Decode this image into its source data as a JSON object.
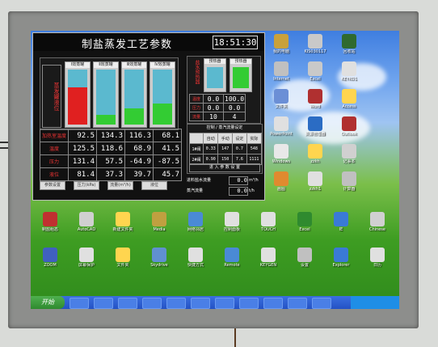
{
  "window": {
    "title": "制盐蒸发工艺参数",
    "time": "18:51:30"
  },
  "tanks": {
    "label": "蒸发罐液位",
    "items": [
      {
        "name": "Ⅰ效蒸罐",
        "level": 0.68,
        "color": "#e02020"
      },
      {
        "name": "Ⅱ效蒸罐",
        "level": 0.18,
        "color": "#33cc33"
      },
      {
        "name": "Ⅲ效蒸罐",
        "level": 0.3,
        "color": "#33cc33"
      },
      {
        "name": "Ⅳ效蒸罐",
        "level": 0.38,
        "color": "#33cc33"
      }
    ]
  },
  "params": {
    "rows": [
      {
        "label": "加热室温度",
        "values": [
          "92.5",
          "134.3",
          "116.3",
          "68.1"
        ]
      },
      {
        "label": "温度",
        "values": [
          "125.5",
          "118.6",
          "68.9",
          "41.5"
        ]
      },
      {
        "label": "压力",
        "values": [
          "131.4",
          "57.5",
          "-64.9",
          "-87.5"
        ]
      },
      {
        "label": "液位",
        "values": [
          "81.4",
          "37.3",
          "39.7",
          "45.7"
        ]
      }
    ]
  },
  "tabs": [
    "参数设置",
    "压力(kPa)",
    "流量(m³/h)",
    "液位"
  ],
  "side": {
    "label": "盐水预热器",
    "tanks": [
      {
        "name": "预热器",
        "color": "#5bb9cf"
      },
      {
        "name": "预热器",
        "color": "#33cc33"
      }
    ],
    "rows": [
      {
        "label": "温度",
        "values": [
          "0.0",
          "100.0"
        ]
      },
      {
        "label": "压力",
        "values": [
          "0.0",
          "0.0"
        ]
      },
      {
        "label": "流量",
        "values": [
          "10",
          "4"
        ]
      }
    ]
  },
  "control": {
    "header": "控制 / 蒸汽流量设定",
    "columns": [
      "自动",
      "手动",
      "设定",
      "实际"
    ],
    "rows": [
      {
        "label": "1#阀",
        "values": [
          "0.33",
          "147",
          "0.7",
          "548"
        ]
      },
      {
        "label": "2#阀",
        "values": [
          "0.90",
          "150",
          "7.6",
          "1111"
        ]
      }
    ],
    "footer": "进 入 参 数 设 置"
  },
  "flow": [
    {
      "label": "进料盐水流量",
      "value": "0.0",
      "unit": "m³/h"
    },
    {
      "label": "蒸汽流量",
      "value": "0.0",
      "unit": "t/h"
    }
  ],
  "desktop": {
    "right_icons": [
      {
        "label": "我的电脑",
        "color": "#c9a13b"
      },
      {
        "label": "KIS030117",
        "color": "#c9c9c9"
      },
      {
        "label": "回收站",
        "color": "#2f6a2f"
      },
      {
        "label": "Internet",
        "color": "#c0c0c0"
      },
      {
        "label": "Excel",
        "color": "#c9c9c9"
      },
      {
        "label": "KEYKO1",
        "color": "#e0e0e0"
      },
      {
        "label": "文件夹",
        "color": "#6b8fd6"
      },
      {
        "label": "Word",
        "color": "#b03030"
      },
      {
        "label": "Access",
        "color": "#ffd54f"
      },
      {
        "label": "PowerPoint",
        "color": "#e0e0e0"
      },
      {
        "label": "资源管理器",
        "color": "#2b6cc4"
      },
      {
        "label": "Outlook",
        "color": "#b03030"
      },
      {
        "label": "Windows",
        "color": "#e8e8e8"
      },
      {
        "label": "zzkh",
        "color": "#ffd54f"
      },
      {
        "label": "记事本",
        "color": "#d0d0d0"
      },
      {
        "label": "画图",
        "color": "#e08a2f"
      },
      {
        "label": "zzkh1",
        "color": "#e0e0e0"
      },
      {
        "label": "计算器",
        "color": "#c0c0c0"
      }
    ],
    "bottom_icons": [
      {
        "label": "制盐组态",
        "color": "#c03030"
      },
      {
        "label": "AutoCAD",
        "color": "#d0d0d0"
      },
      {
        "label": "新建文件夹",
        "color": "#ffd54f"
      },
      {
        "label": "Media",
        "color": "#c0a040"
      },
      {
        "label": "网络邻居",
        "color": "#4a8ad6"
      },
      {
        "label": "控制面板",
        "color": "#e0e0e0"
      },
      {
        "label": "TOUCH",
        "color": "#e0e0e0"
      },
      {
        "label": "Excel",
        "color": "#2f8a2f"
      },
      {
        "label": "IE",
        "color": "#3a7ad6"
      },
      {
        "label": "Chinese",
        "color": "#d0d0d0"
      },
      {
        "label": "ZOOM",
        "color": "#4060c0"
      },
      {
        "label": "屏幕保护",
        "color": "#e0e0e0"
      },
      {
        "label": "文件夹",
        "color": "#ffd54f"
      },
      {
        "label": "Skydrive",
        "color": "#6090d0"
      },
      {
        "label": "快捷方式",
        "color": "#e0e0e0"
      },
      {
        "label": "Remote",
        "color": "#4a8ad6"
      },
      {
        "label": "KEYGEN",
        "color": "#e0e0e0"
      },
      {
        "label": "设置",
        "color": "#c0c0c0"
      },
      {
        "label": "Explorer",
        "color": "#3a7ad6"
      },
      {
        "label": "日历",
        "color": "#e0e0e0"
      }
    ]
  },
  "taskbar": {
    "start_label": "开始",
    "buttons": 11
  }
}
